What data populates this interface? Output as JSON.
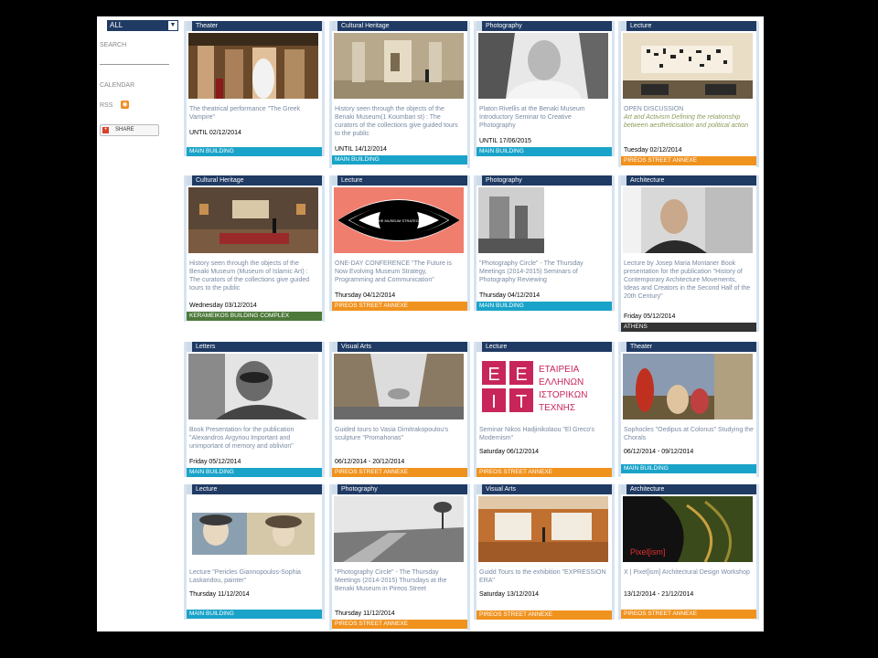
{
  "sidebar": {
    "filter_value": "ALL",
    "search_label": "SEARCH",
    "calendar_label": "CALENDAR",
    "rss_label": "RSS",
    "share_label": "SHARE"
  },
  "cards": [
    {
      "category": "Theater",
      "title": "The theatrical performance \"The Greek Vampire\"",
      "date": "UNTIL 02/12/2014",
      "location": "MAIN BUILDING"
    },
    {
      "category": "Cultural Heritage",
      "title": "History seen through the objects of the Benaki Museum(1 Koumbari st) : The curators of the collections give guided tours to the public",
      "date": "UNTIL 14/12/2014",
      "location": "MAIN BUILDING"
    },
    {
      "category": "Photography",
      "title": "Platon Rivellis at the Benaki Museum Introductory Seminar to Creative Photography",
      "date": "UNTIL 17/06/2015",
      "location": "MAIN BUILDING"
    },
    {
      "category": "Lecture",
      "title": "OPEN DISCUSSION",
      "subtitle": "Art and Activism Defining the relationship between aestheticisation and political action",
      "date": "Tuesday 02/12/2014",
      "location": "PIREOS STREET ANNEXE"
    },
    {
      "category": "Cultural Heritage",
      "title": "History seen through the objects of the Benaki Museum (Museum of Islamic Art) : The curators of the collections give guided tours to the public",
      "date": "Wednesday 03/12/2014",
      "location": "KERAMEIKOS BUILDING COMPLEX"
    },
    {
      "category": "Lecture",
      "title": "ONE-DAY CONFERENCE \"The Future is Now Evolving Museum Strategy, Programming and Communication\"",
      "date": "Thursday 04/12/2014",
      "location": "PIREOS STREET ANNEXE"
    },
    {
      "category": "Photography",
      "title": "\"Photography Circle\" - The Thursday Meetings (2014-2015) Seminars of Photography Reviewing",
      "date": "Thursday 04/12/2014",
      "location": "MAIN BUILDING"
    },
    {
      "category": "Architecture",
      "title": "Lecture by Josep Maria Montaner Book presentation for the publication \"History of Contemporary Architecture Movements, Ideas and Creators in the Second Half of the 20th Century\"",
      "date": "Friday 05/12/2014",
      "location": "ATHENS"
    },
    {
      "category": "Letters",
      "title": "Book Presentation for the publication \"Alexandros Argyriou Important and unimportant of memory and oblivion\"",
      "date": "Friday 05/12/2014",
      "location": "MAIN BUILDING"
    },
    {
      "category": "Visual Arts",
      "title": "Guided tours to Vasia Dimitrakopoulou's sculpture \"Promahonas\"",
      "date": "06/12/2014 - 20/12/2014",
      "location": "PIREOS STREET ANNEXE"
    },
    {
      "category": "Lecture",
      "title": "Seminar Nikos Hadjinikolaou \"El Greco's Modernism\"",
      "date": "Saturday 06/12/2014",
      "location": "PIREOS STREET ANNEXE"
    },
    {
      "category": "Theater",
      "title": "Sophocles \"Oedipus at Colonus\" Studying the Chorals",
      "date": "06/12/2014 - 09/12/2014",
      "location": "MAIN BUILDING"
    },
    {
      "category": "Lecture",
      "title": "Lecture \"Pericles Giannopoulos-Sophia Laskaridou, painter\"",
      "date": "Thursday 11/12/2014",
      "location": "MAIN BUILDING"
    },
    {
      "category": "Photography",
      "title": "\"Photography Circle\" - The Thursday Meetings (2014-2015) Thursdays at the Benaki Museum in Pireos Street",
      "date": "Thursday 11/12/2014",
      "location": "PIREOS STREET ANNEXE"
    },
    {
      "category": "Visual Arts",
      "title": "Guidd Tours to the exhibition \"EXPRESSION ERA\"",
      "date": "Saturday 13/12/2014",
      "location": "PIREOS STREET ANNEXE"
    },
    {
      "category": "Architecture",
      "title": "X | Pixel[ism] Architectural Design Workshop",
      "date": "13/12/2014 - 21/12/2014",
      "location": "PIREOS STREET ANNEXE"
    }
  ],
  "graphics": {
    "eye_caption": "THE MUSEUM STRATEGY",
    "eeit_letters": [
      "Ε",
      "Ε",
      "Ι",
      "Τ"
    ],
    "eeit_text": [
      "ΕΤΑΙΡΕΙΑ",
      "ΕΛΛΗΝΩΝ",
      "ΙΣΤΟΡΙΚΩΝ",
      "ΤΕΧΝΗΣ"
    ],
    "pixel_logo": "Pixel[ism]"
  }
}
